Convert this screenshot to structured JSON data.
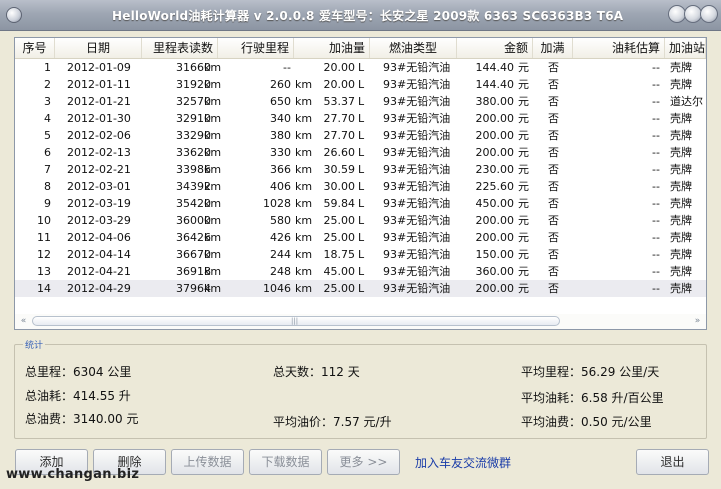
{
  "window": {
    "title": "HelloWorld油耗计算器 v 2.0.0.8  爱车型号：长安之星 2009款 6363 SC6363B3 T6A"
  },
  "table": {
    "columns": [
      "序号",
      "日期",
      "里程表读数",
      "行驶里程",
      "加油量",
      "燃油类型",
      "金额",
      "加满",
      "油耗估算",
      "加油站"
    ],
    "rows": [
      {
        "no": "1",
        "date": "2012-01-09",
        "odo": "31660",
        "odo_unit": "km",
        "dist": "--",
        "dist_unit": "",
        "fuel": "20.00",
        "fuel_unit": "L",
        "type": "93#无铅汽油",
        "amount": "144.40",
        "amount_unit": "元",
        "full": "否",
        "est": "--",
        "station": "壳牌"
      },
      {
        "no": "2",
        "date": "2012-01-11",
        "odo": "31920",
        "odo_unit": "km",
        "dist": "260",
        "dist_unit": "km",
        "fuel": "20.00",
        "fuel_unit": "L",
        "type": "93#无铅汽油",
        "amount": "144.40",
        "amount_unit": "元",
        "full": "否",
        "est": "--",
        "station": "壳牌"
      },
      {
        "no": "3",
        "date": "2012-01-21",
        "odo": "32570",
        "odo_unit": "km",
        "dist": "650",
        "dist_unit": "km",
        "fuel": "53.37",
        "fuel_unit": "L",
        "type": "93#无铅汽油",
        "amount": "380.00",
        "amount_unit": "元",
        "full": "否",
        "est": "--",
        "station": "道达尔"
      },
      {
        "no": "4",
        "date": "2012-01-30",
        "odo": "32910",
        "odo_unit": "km",
        "dist": "340",
        "dist_unit": "km",
        "fuel": "27.70",
        "fuel_unit": "L",
        "type": "93#无铅汽油",
        "amount": "200.00",
        "amount_unit": "元",
        "full": "否",
        "est": "--",
        "station": "壳牌"
      },
      {
        "no": "5",
        "date": "2012-02-06",
        "odo": "33290",
        "odo_unit": "km",
        "dist": "380",
        "dist_unit": "km",
        "fuel": "27.70",
        "fuel_unit": "L",
        "type": "93#无铅汽油",
        "amount": "200.00",
        "amount_unit": "元",
        "full": "否",
        "est": "--",
        "station": "壳牌"
      },
      {
        "no": "6",
        "date": "2012-02-13",
        "odo": "33620",
        "odo_unit": "km",
        "dist": "330",
        "dist_unit": "km",
        "fuel": "26.60",
        "fuel_unit": "L",
        "type": "93#无铅汽油",
        "amount": "200.00",
        "amount_unit": "元",
        "full": "否",
        "est": "--",
        "station": "壳牌"
      },
      {
        "no": "7",
        "date": "2012-02-21",
        "odo": "33986",
        "odo_unit": "km",
        "dist": "366",
        "dist_unit": "km",
        "fuel": "30.59",
        "fuel_unit": "L",
        "type": "93#无铅汽油",
        "amount": "230.00",
        "amount_unit": "元",
        "full": "否",
        "est": "--",
        "station": "壳牌"
      },
      {
        "no": "8",
        "date": "2012-03-01",
        "odo": "34392",
        "odo_unit": "km",
        "dist": "406",
        "dist_unit": "km",
        "fuel": "30.00",
        "fuel_unit": "L",
        "type": "93#无铅汽油",
        "amount": "225.60",
        "amount_unit": "元",
        "full": "否",
        "est": "--",
        "station": "壳牌"
      },
      {
        "no": "9",
        "date": "2012-03-19",
        "odo": "35420",
        "odo_unit": "km",
        "dist": "1028",
        "dist_unit": "km",
        "fuel": "59.84",
        "fuel_unit": "L",
        "type": "93#无铅汽油",
        "amount": "450.00",
        "amount_unit": "元",
        "full": "否",
        "est": "--",
        "station": "壳牌"
      },
      {
        "no": "10",
        "date": "2012-03-29",
        "odo": "36000",
        "odo_unit": "km",
        "dist": "580",
        "dist_unit": "km",
        "fuel": "25.00",
        "fuel_unit": "L",
        "type": "93#无铅汽油",
        "amount": "200.00",
        "amount_unit": "元",
        "full": "否",
        "est": "--",
        "station": "壳牌"
      },
      {
        "no": "11",
        "date": "2012-04-06",
        "odo": "36426",
        "odo_unit": "km",
        "dist": "426",
        "dist_unit": "km",
        "fuel": "25.00",
        "fuel_unit": "L",
        "type": "93#无铅汽油",
        "amount": "200.00",
        "amount_unit": "元",
        "full": "否",
        "est": "--",
        "station": "壳牌"
      },
      {
        "no": "12",
        "date": "2012-04-14",
        "odo": "36670",
        "odo_unit": "km",
        "dist": "244",
        "dist_unit": "km",
        "fuel": "18.75",
        "fuel_unit": "L",
        "type": "93#无铅汽油",
        "amount": "150.00",
        "amount_unit": "元",
        "full": "否",
        "est": "--",
        "station": "壳牌"
      },
      {
        "no": "13",
        "date": "2012-04-21",
        "odo": "36918",
        "odo_unit": "km",
        "dist": "248",
        "dist_unit": "km",
        "fuel": "45.00",
        "fuel_unit": "L",
        "type": "93#无铅汽油",
        "amount": "360.00",
        "amount_unit": "元",
        "full": "否",
        "est": "--",
        "station": "壳牌"
      },
      {
        "no": "14",
        "date": "2012-04-29",
        "odo": "37964",
        "odo_unit": "km",
        "dist": "1046",
        "dist_unit": "km",
        "fuel": "25.00",
        "fuel_unit": "L",
        "type": "93#无铅汽油",
        "amount": "200.00",
        "amount_unit": "元",
        "full": "否",
        "est": "--",
        "station": "壳牌"
      }
    ]
  },
  "stats": {
    "legend": "统计",
    "total_mileage": "总里程：6304 公里",
    "total_days": "总天数：112 天",
    "avg_mileage": "平均里程：56.29 公里/天",
    "total_fuel": "总油耗：414.55 升",
    "avg_consumption": "平均油耗：6.58 升/百公里",
    "total_cost": "总油费：3140.00 元",
    "avg_price": "平均油价：7.57 元/升",
    "avg_cost": "平均油费：0.50 元/公里"
  },
  "buttons": {
    "add": "添加",
    "delete": "删除",
    "upload": "上传数据",
    "download": "下载数据",
    "more": "更多 >>",
    "exit": "退出"
  },
  "link": "加入车友交流微群",
  "watermark": "www.changan.biz"
}
